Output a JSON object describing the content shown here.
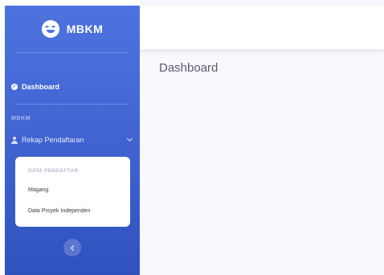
{
  "brand": {
    "name": "MBKM",
    "icon": "smile-icon"
  },
  "sidebar": {
    "dashboard": {
      "label": "Dashboard",
      "icon": "dashboard-icon"
    },
    "heading": "MBKM",
    "rekap": {
      "label": "Rekap Pendaftaran",
      "icon": "user-icon",
      "expanded": true
    },
    "submenu": {
      "header": "DATA PENDAFTAR",
      "items": [
        {
          "label": "Magang"
        },
        {
          "label": "Data Proyek Independen"
        }
      ]
    },
    "toggle_icon": "chevron-left-icon"
  },
  "main": {
    "title": "Dashboard"
  },
  "colors": {
    "sidebar_top": "#4e73df",
    "sidebar_bottom": "#2f52bd",
    "content_bg": "#f8f9fc",
    "title": "#5a5c69"
  }
}
